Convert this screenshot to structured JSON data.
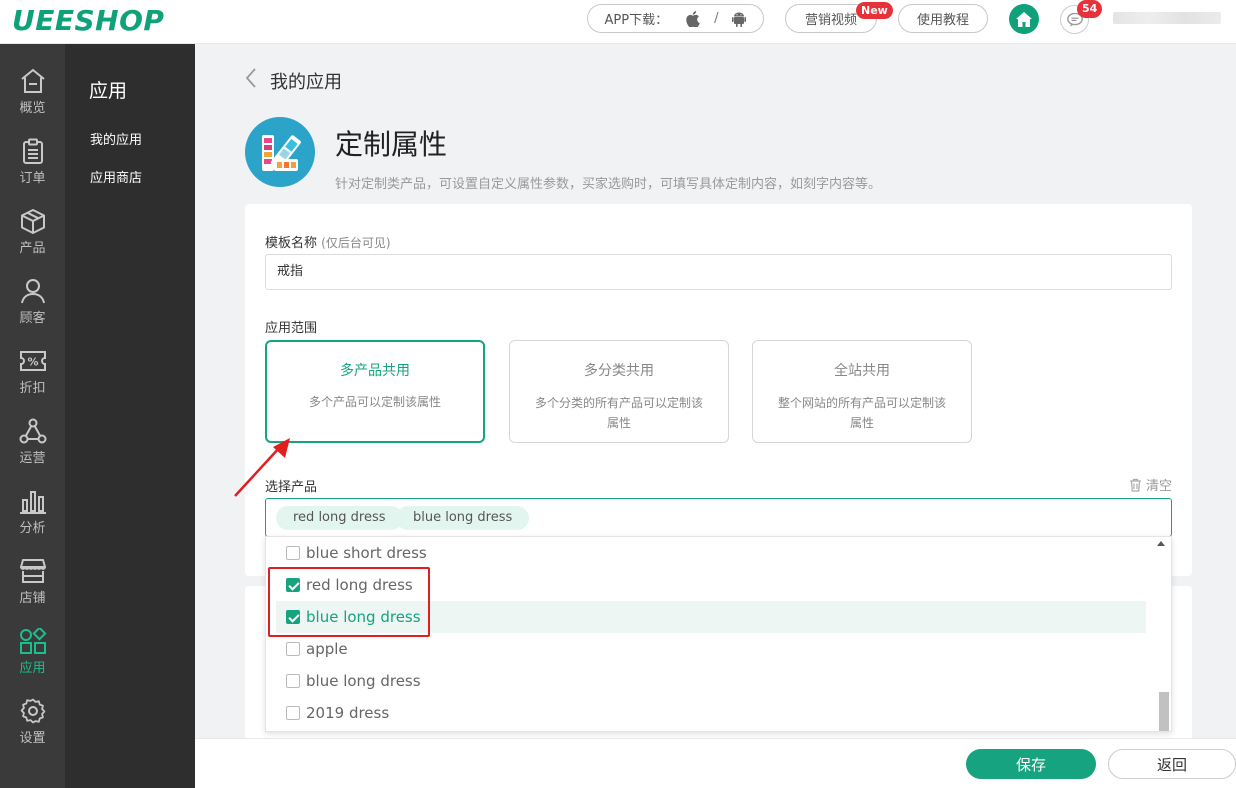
{
  "header": {
    "logo": "UEESHOP",
    "app_download_label": "APP下载：",
    "app_download_sep": "/",
    "marketing_video": "营销视频",
    "new_badge": "New",
    "tutorial": "使用教程",
    "message_count": "54",
    "accent_color": "#0fa17a"
  },
  "leftnav": {
    "items": [
      {
        "label": "概览",
        "icon": "home-outline-icon"
      },
      {
        "label": "订单",
        "icon": "clipboard-icon"
      },
      {
        "label": "产品",
        "icon": "box-icon"
      },
      {
        "label": "顾客",
        "icon": "user-icon"
      },
      {
        "label": "折扣",
        "icon": "percent-ticket-icon"
      },
      {
        "label": "运营",
        "icon": "nodes-icon"
      },
      {
        "label": "分析",
        "icon": "bar-chart-icon"
      },
      {
        "label": "店铺",
        "icon": "store-icon"
      },
      {
        "label": "应用",
        "icon": "apps-icon"
      },
      {
        "label": "设置",
        "icon": "gear-icon"
      }
    ],
    "active": "应用"
  },
  "subnav": {
    "title": "应用",
    "items": [
      "我的应用",
      "应用商店"
    ]
  },
  "page": {
    "breadcrumb": "我的应用",
    "title": "定制属性",
    "description": "针对定制类产品，可设置自定义属性参数，买家选购时，可填写具体定制内容，如刻字内容等。"
  },
  "form": {
    "template_label": "模板名称",
    "template_hint": "(仅后台可见)",
    "template_value": "戒指",
    "scope_label": "应用范围",
    "scopes": [
      {
        "name": "多产品共用",
        "desc": "多个产品可以定制该属性",
        "selected": true
      },
      {
        "name": "多分类共用",
        "desc": "多个分类的所有产品可以定制该属性",
        "selected": false
      },
      {
        "name": "全站共用",
        "desc": "整个网站的所有产品可以定制该属性",
        "selected": false
      }
    ],
    "select_label": "选择产品",
    "clear_label": "清空",
    "selected_tags": [
      "red long dress",
      "blue long dress"
    ]
  },
  "dropdown": {
    "options": [
      {
        "label": "blue short dress",
        "checked": false
      },
      {
        "label": "red long dress",
        "checked": true
      },
      {
        "label": "blue long dress",
        "checked": true,
        "highlighted": true
      },
      {
        "label": "apple",
        "checked": false
      },
      {
        "label": "blue long dress",
        "checked": false
      },
      {
        "label": "2019 dress",
        "checked": false
      }
    ]
  },
  "footer": {
    "save": "保存",
    "back": "返回"
  }
}
